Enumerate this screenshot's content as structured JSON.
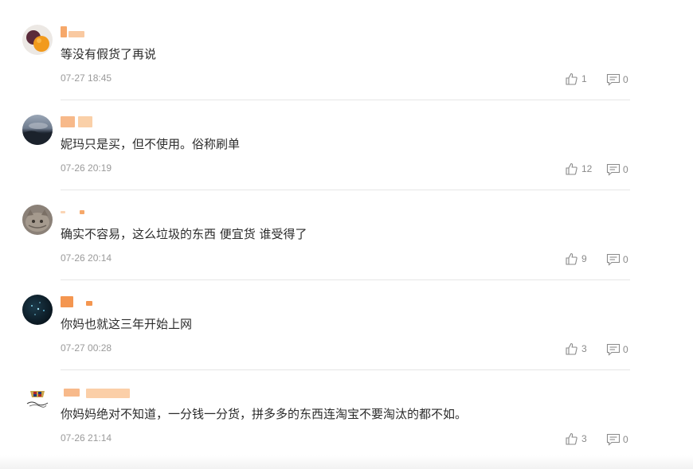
{
  "comments": [
    {
      "text": "等没有假货了再说",
      "time": "07-27 18:45",
      "likes": "1",
      "replies": "0",
      "avatar": "fruit-avatar"
    },
    {
      "text": "妮玛只是买，但不使用。俗称刷单",
      "time": "07-26 20:19",
      "likes": "12",
      "replies": "0",
      "avatar": "sky-avatar"
    },
    {
      "text": "确实不容易，这么垃圾的东西 便宜货 谁受得了",
      "time": "07-26 20:14",
      "likes": "9",
      "replies": "0",
      "avatar": "cat-avatar"
    },
    {
      "text": "你妈也就这三年开始上网",
      "time": "07-27 00:28",
      "likes": "3",
      "replies": "0",
      "avatar": "night-avatar"
    },
    {
      "text": "你妈妈绝对不知道，一分钱一分货，拼多多的东西连淘宝不要淘汰的都不如。",
      "time": "07-26 21:14",
      "likes": "3",
      "replies": "0",
      "avatar": "cadillac-avatar"
    }
  ]
}
